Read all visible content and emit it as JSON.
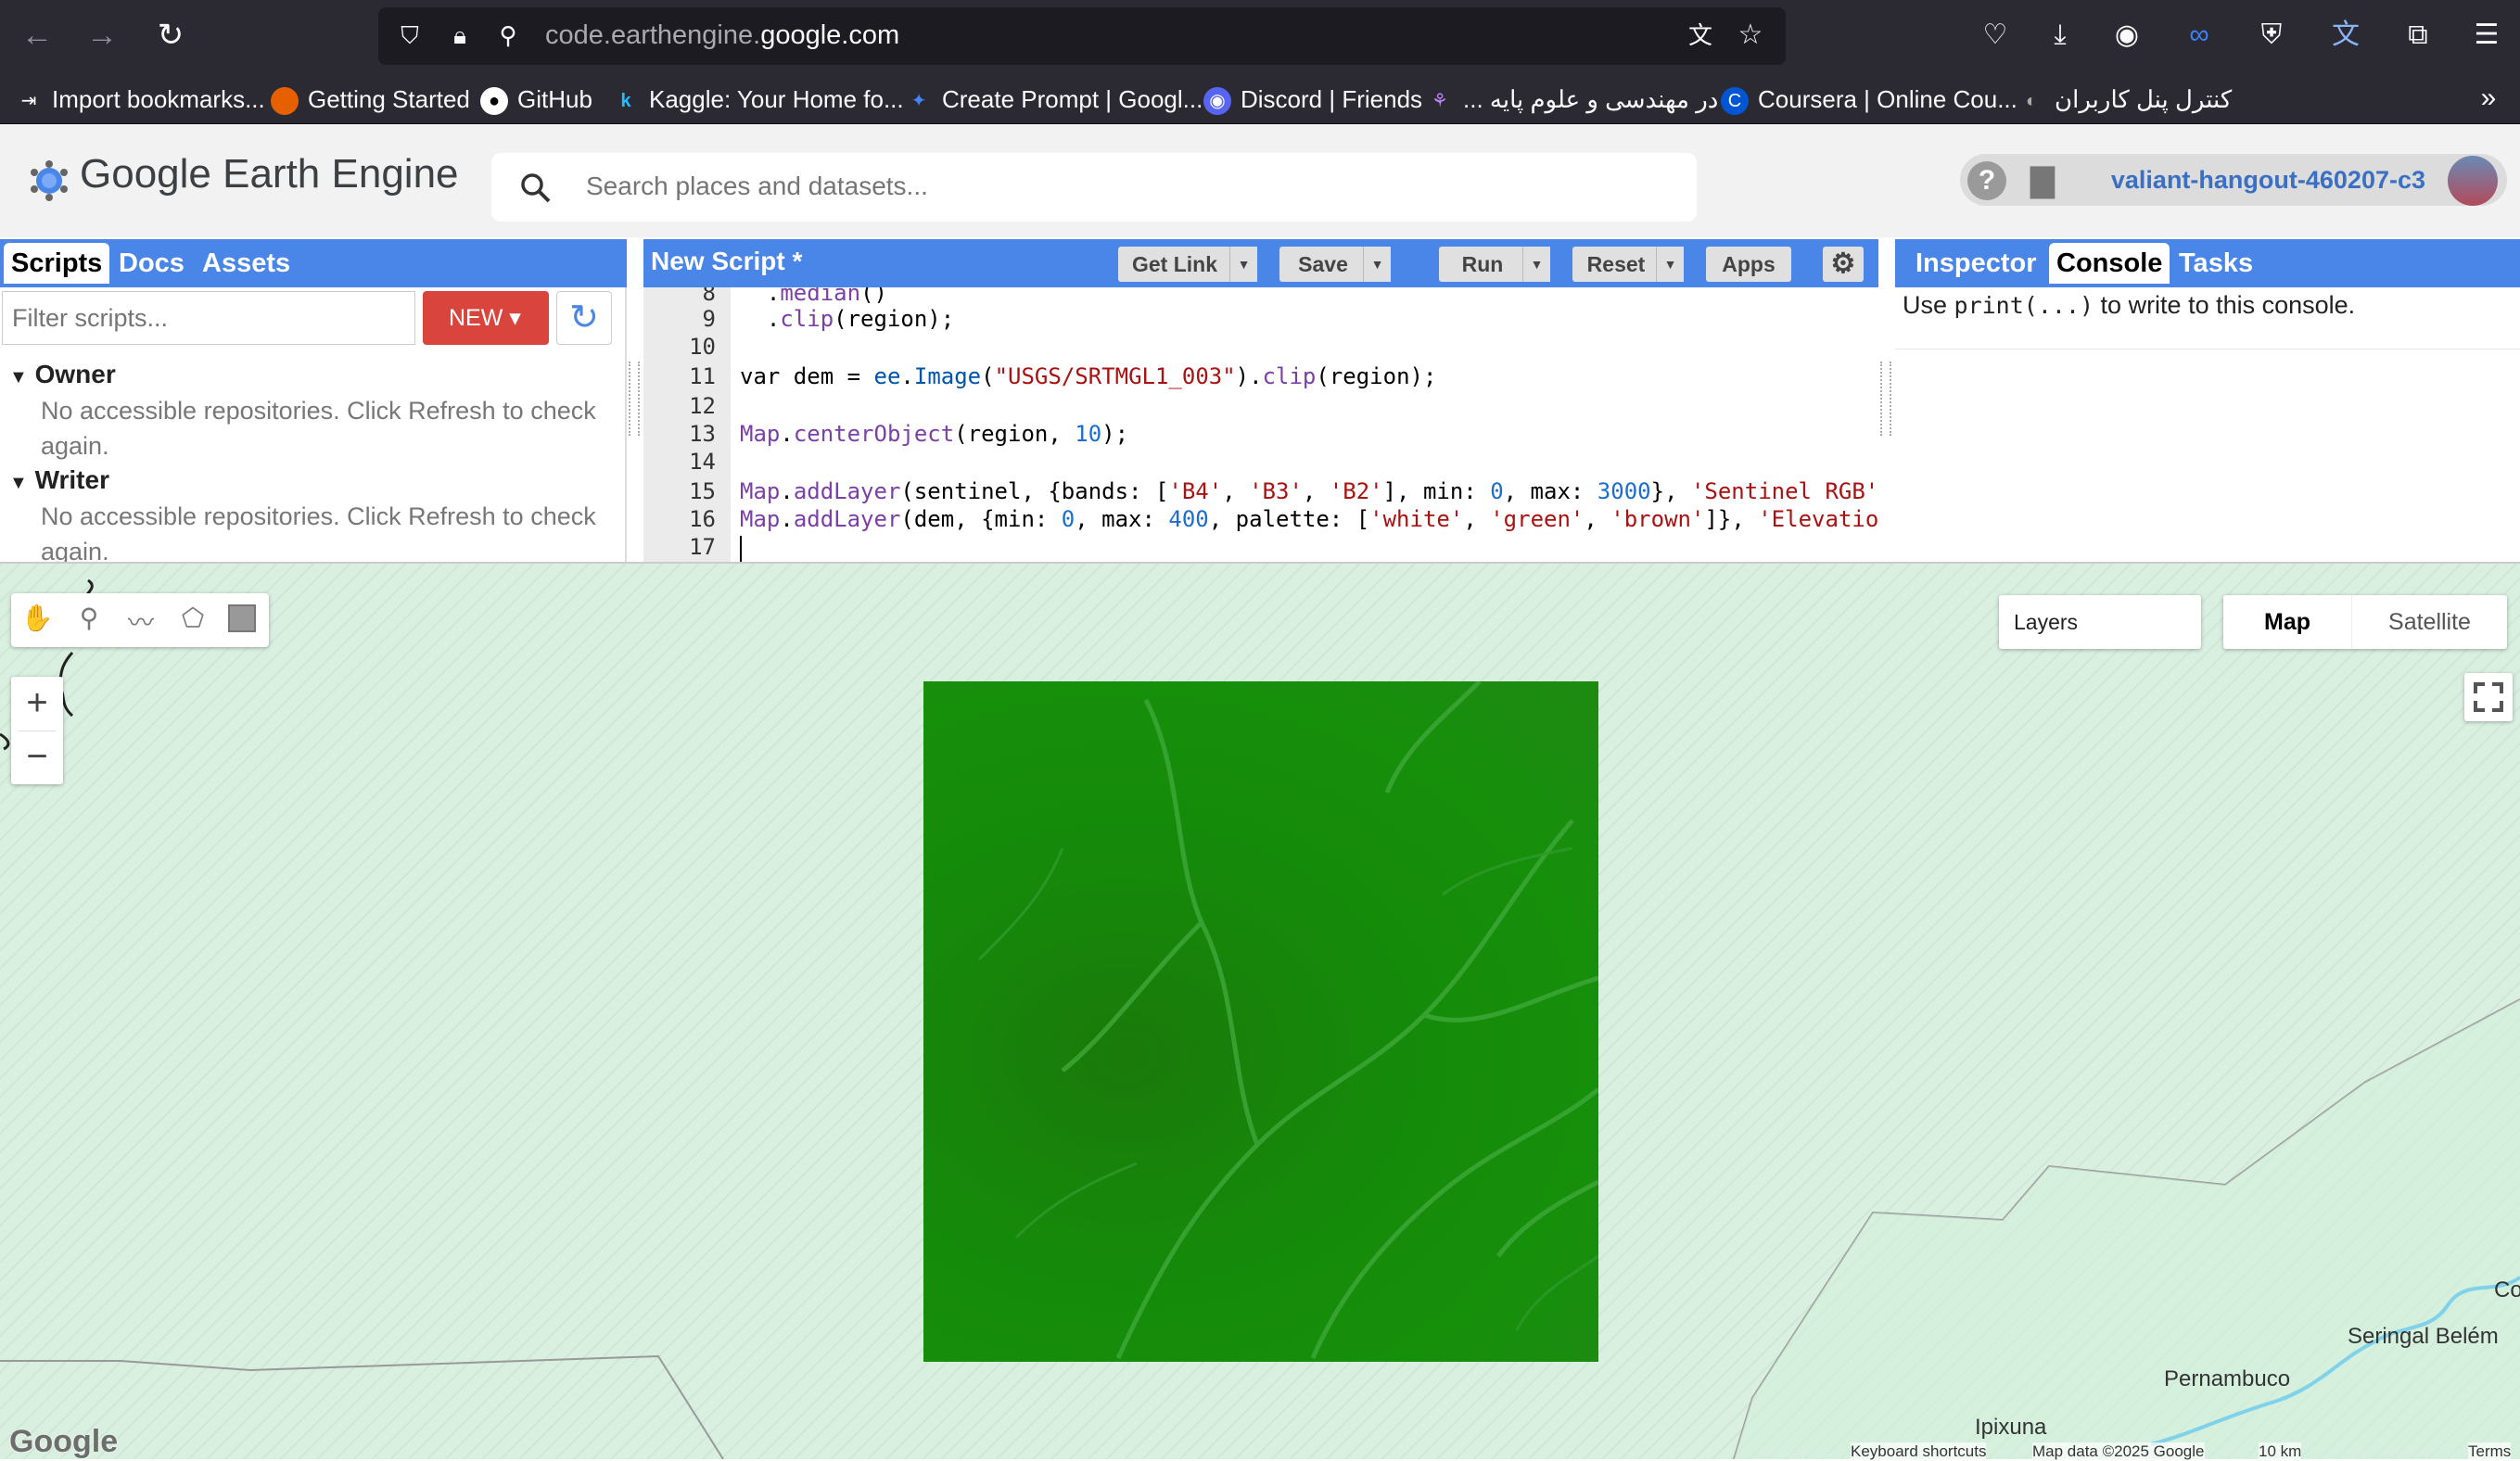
{
  "browser": {
    "url_prefix": "code.earthengine.",
    "url_domain": "google.com",
    "bookmarks": [
      {
        "label": "Import bookmarks..."
      },
      {
        "label": "Getting Started"
      },
      {
        "label": "GitHub"
      },
      {
        "label": "Kaggle: Your Home fo..."
      },
      {
        "label": "Create Prompt | Googl..."
      },
      {
        "label": "Discord | Friends"
      },
      {
        "label": "... در مهندسی و علوم پایه"
      },
      {
        "label": "Coursera | Online Cou..."
      },
      {
        "label": "کنترل پنل کاربران"
      }
    ]
  },
  "app": {
    "title": "Google Earth Engine",
    "search_placeholder": "Search places and datasets...",
    "project": "valiant-hangout-460207-c3"
  },
  "left_panel": {
    "tabs": [
      "Scripts",
      "Docs",
      "Assets"
    ],
    "filter_placeholder": "Filter scripts...",
    "new_label": "NEW",
    "sections": [
      {
        "title": "Owner",
        "message": "No accessible repositories. Click Refresh to check again."
      },
      {
        "title": "Writer",
        "message": "No accessible repositories. Click Refresh to check again."
      }
    ]
  },
  "editor": {
    "title": "New Script *",
    "buttons": {
      "get_link": "Get Link",
      "save": "Save",
      "run": "Run",
      "reset": "Reset",
      "apps": "Apps"
    },
    "line_numbers": [
      "8",
      "9",
      "10",
      "11",
      "12",
      "13",
      "14",
      "15",
      "16",
      "17"
    ]
  },
  "right_panel": {
    "tabs": [
      "Inspector",
      "Console",
      "Tasks"
    ],
    "console_prefix": "Use ",
    "console_code": "print(...)",
    "console_suffix": " to write to this console."
  },
  "map": {
    "layers_label": "Layers",
    "map_type": [
      "Map",
      "Satellite"
    ],
    "places": [
      "Seringal Belém",
      "Pernambuco",
      "Ipixuna",
      "Co"
    ],
    "footer": [
      "Keyboard shortcuts",
      "Map data ©2025 Google",
      "10 km",
      "Terms"
    ],
    "google_logo": "Google"
  }
}
